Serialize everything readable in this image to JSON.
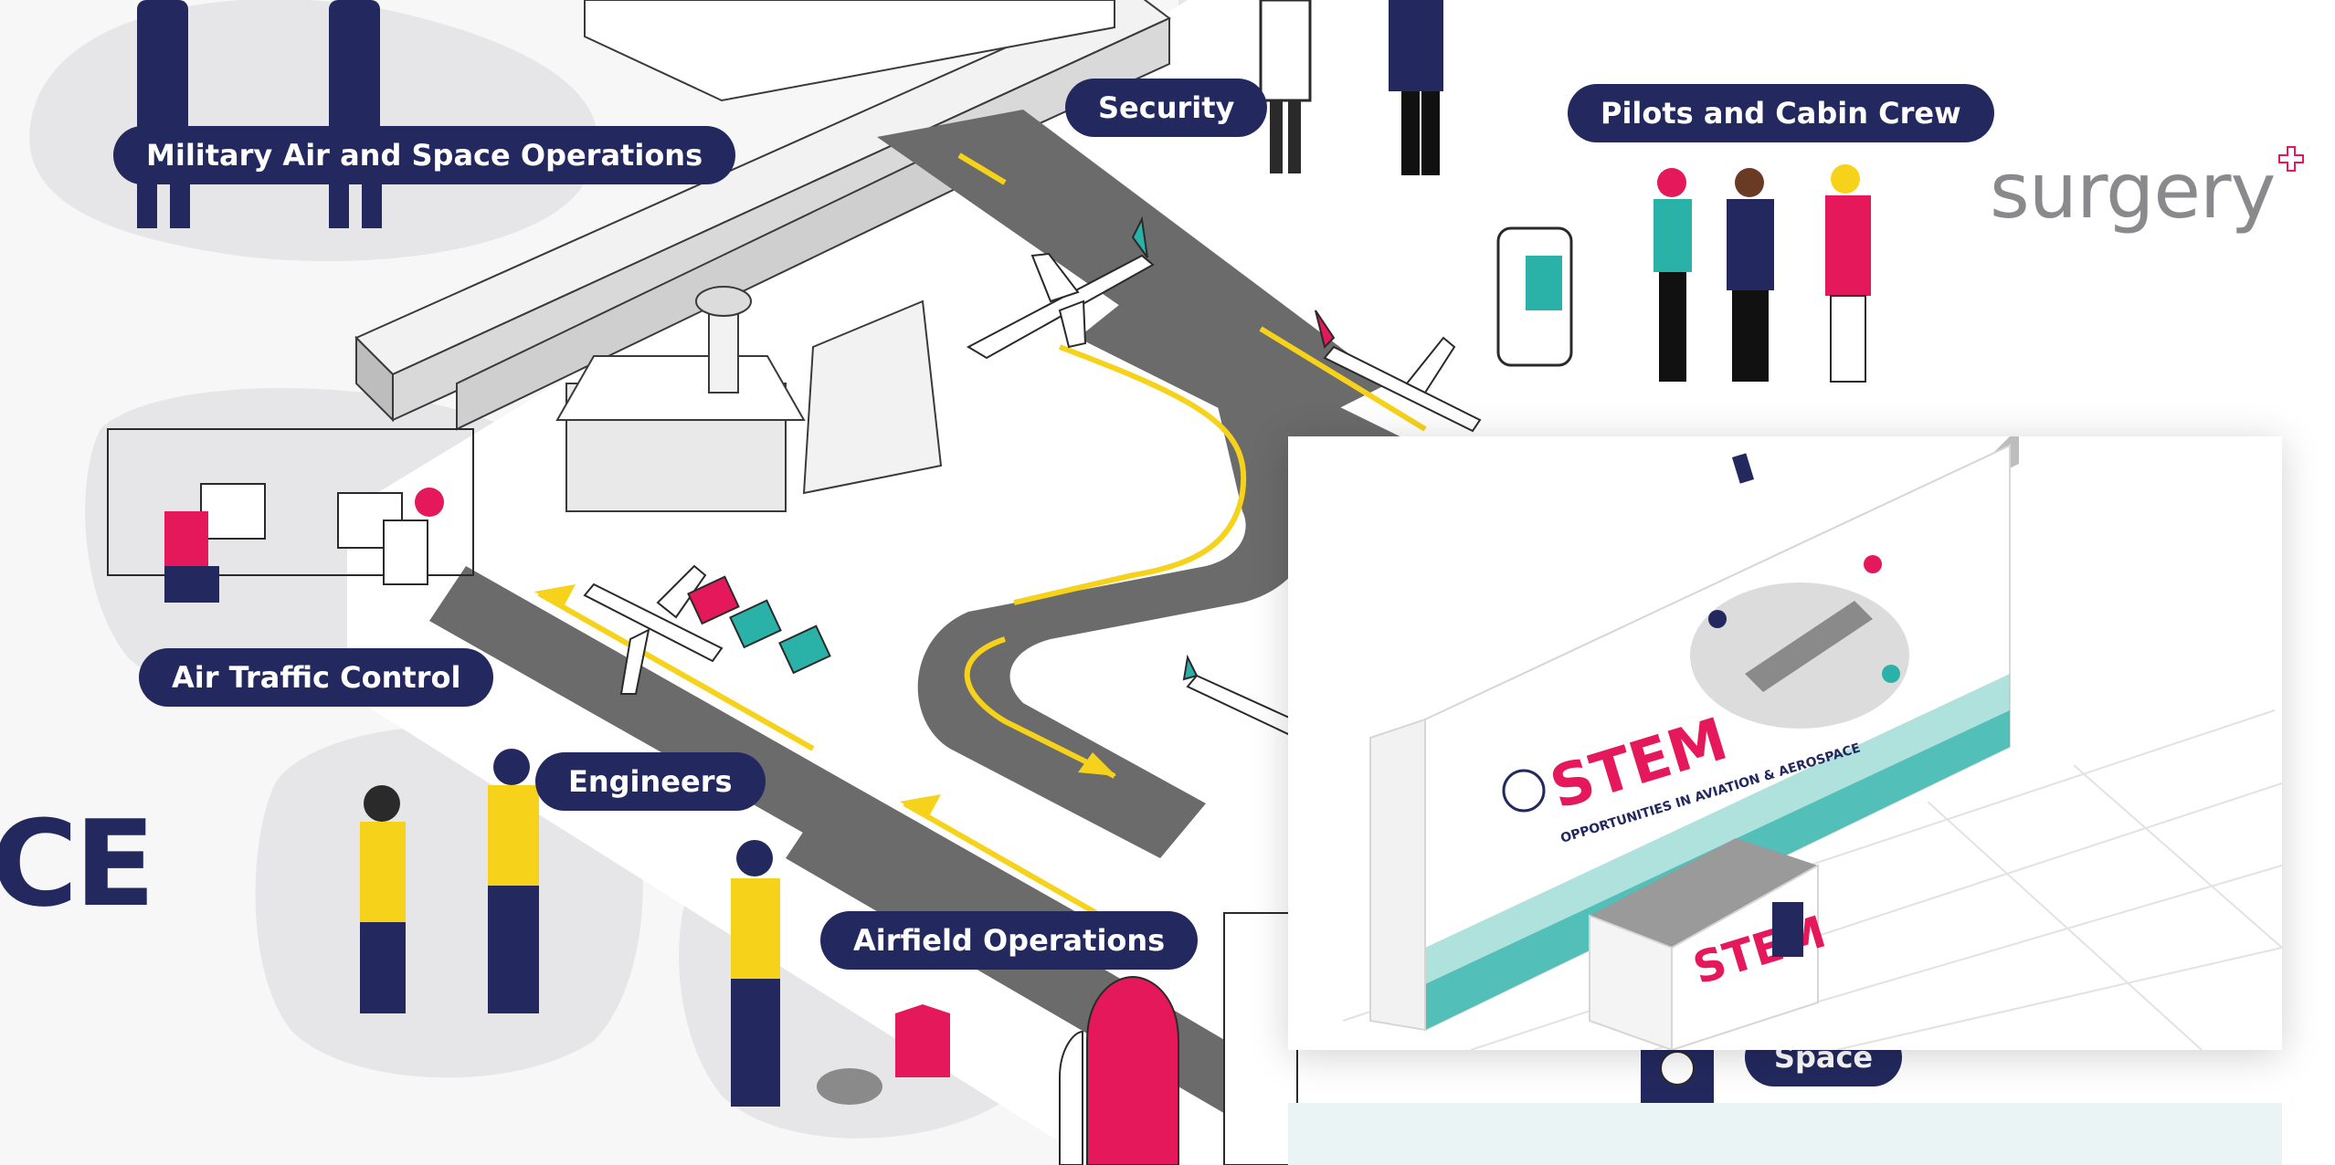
{
  "labels": {
    "military": "Military Air and Space Operations",
    "security": "Security",
    "pilots": "Pilots and Cabin Crew",
    "atc": "Air Traffic Control",
    "engineers": "Engineers",
    "airfield": "Airfield Operations",
    "space": "Space"
  },
  "left_cut_text": "CE",
  "brand": {
    "name": "surgery"
  },
  "popup": {
    "stem_text": "STEM",
    "subtitle": "OPPORTUNITIES IN AVIATION & AEROSPACE"
  },
  "colors": {
    "navy": "#23295e",
    "yellow": "#f6d21a",
    "pink": "#e4185a",
    "teal": "#2bb2a8",
    "grey_road": "#6b6b6b",
    "blob": "#e6e6e8"
  }
}
